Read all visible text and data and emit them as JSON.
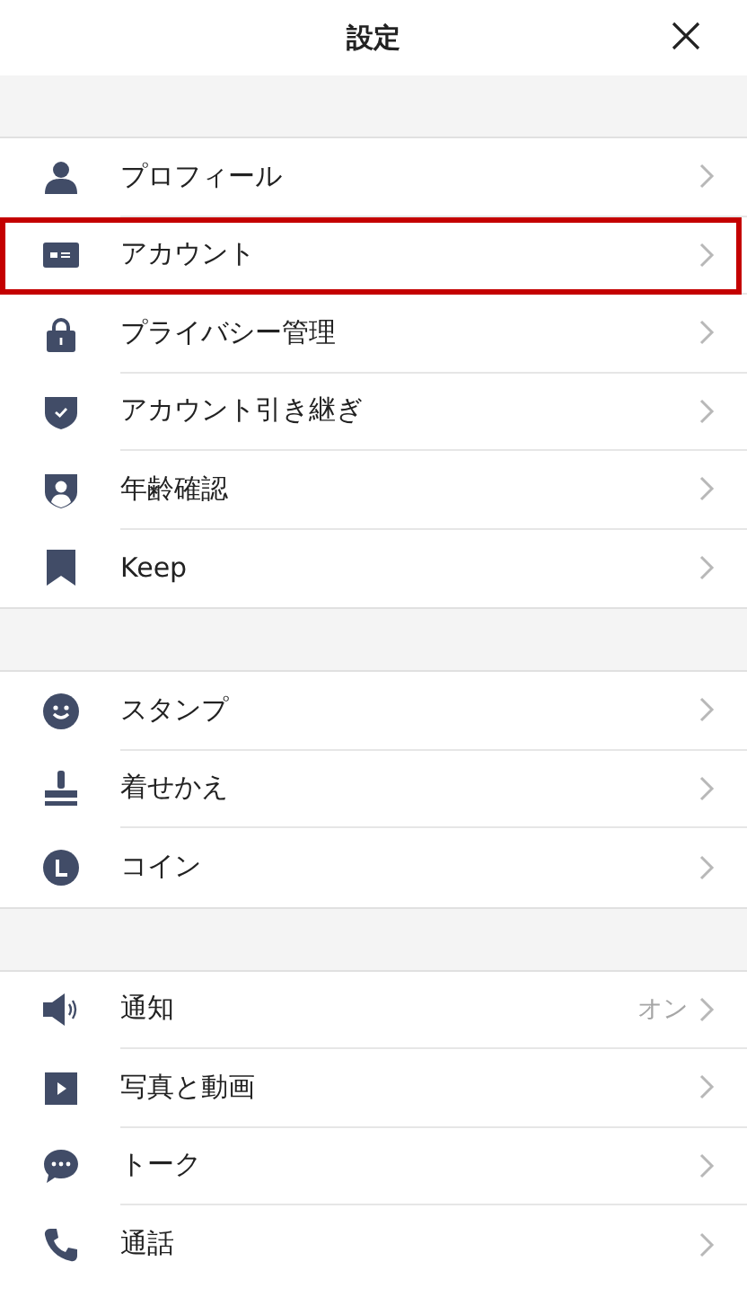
{
  "header": {
    "title": "設定"
  },
  "sections": [
    {
      "items": [
        {
          "label": "プロフィール",
          "highlighted": false
        },
        {
          "label": "アカウント",
          "highlighted": true
        },
        {
          "label": "プライバシー管理",
          "highlighted": false
        },
        {
          "label": "アカウント引き継ぎ",
          "highlighted": false
        },
        {
          "label": "年齢確認",
          "highlighted": false
        },
        {
          "label": "Keep",
          "highlighted": false
        }
      ]
    },
    {
      "items": [
        {
          "label": "スタンプ",
          "highlighted": false
        },
        {
          "label": "着せかえ",
          "highlighted": false
        },
        {
          "label": "コイン",
          "highlighted": false
        }
      ]
    },
    {
      "items": [
        {
          "label": "通知",
          "value": "オン",
          "highlighted": false
        },
        {
          "label": "写真と動画",
          "highlighted": false
        },
        {
          "label": "トーク",
          "highlighted": false
        },
        {
          "label": "通話",
          "highlighted": false
        }
      ]
    }
  ]
}
